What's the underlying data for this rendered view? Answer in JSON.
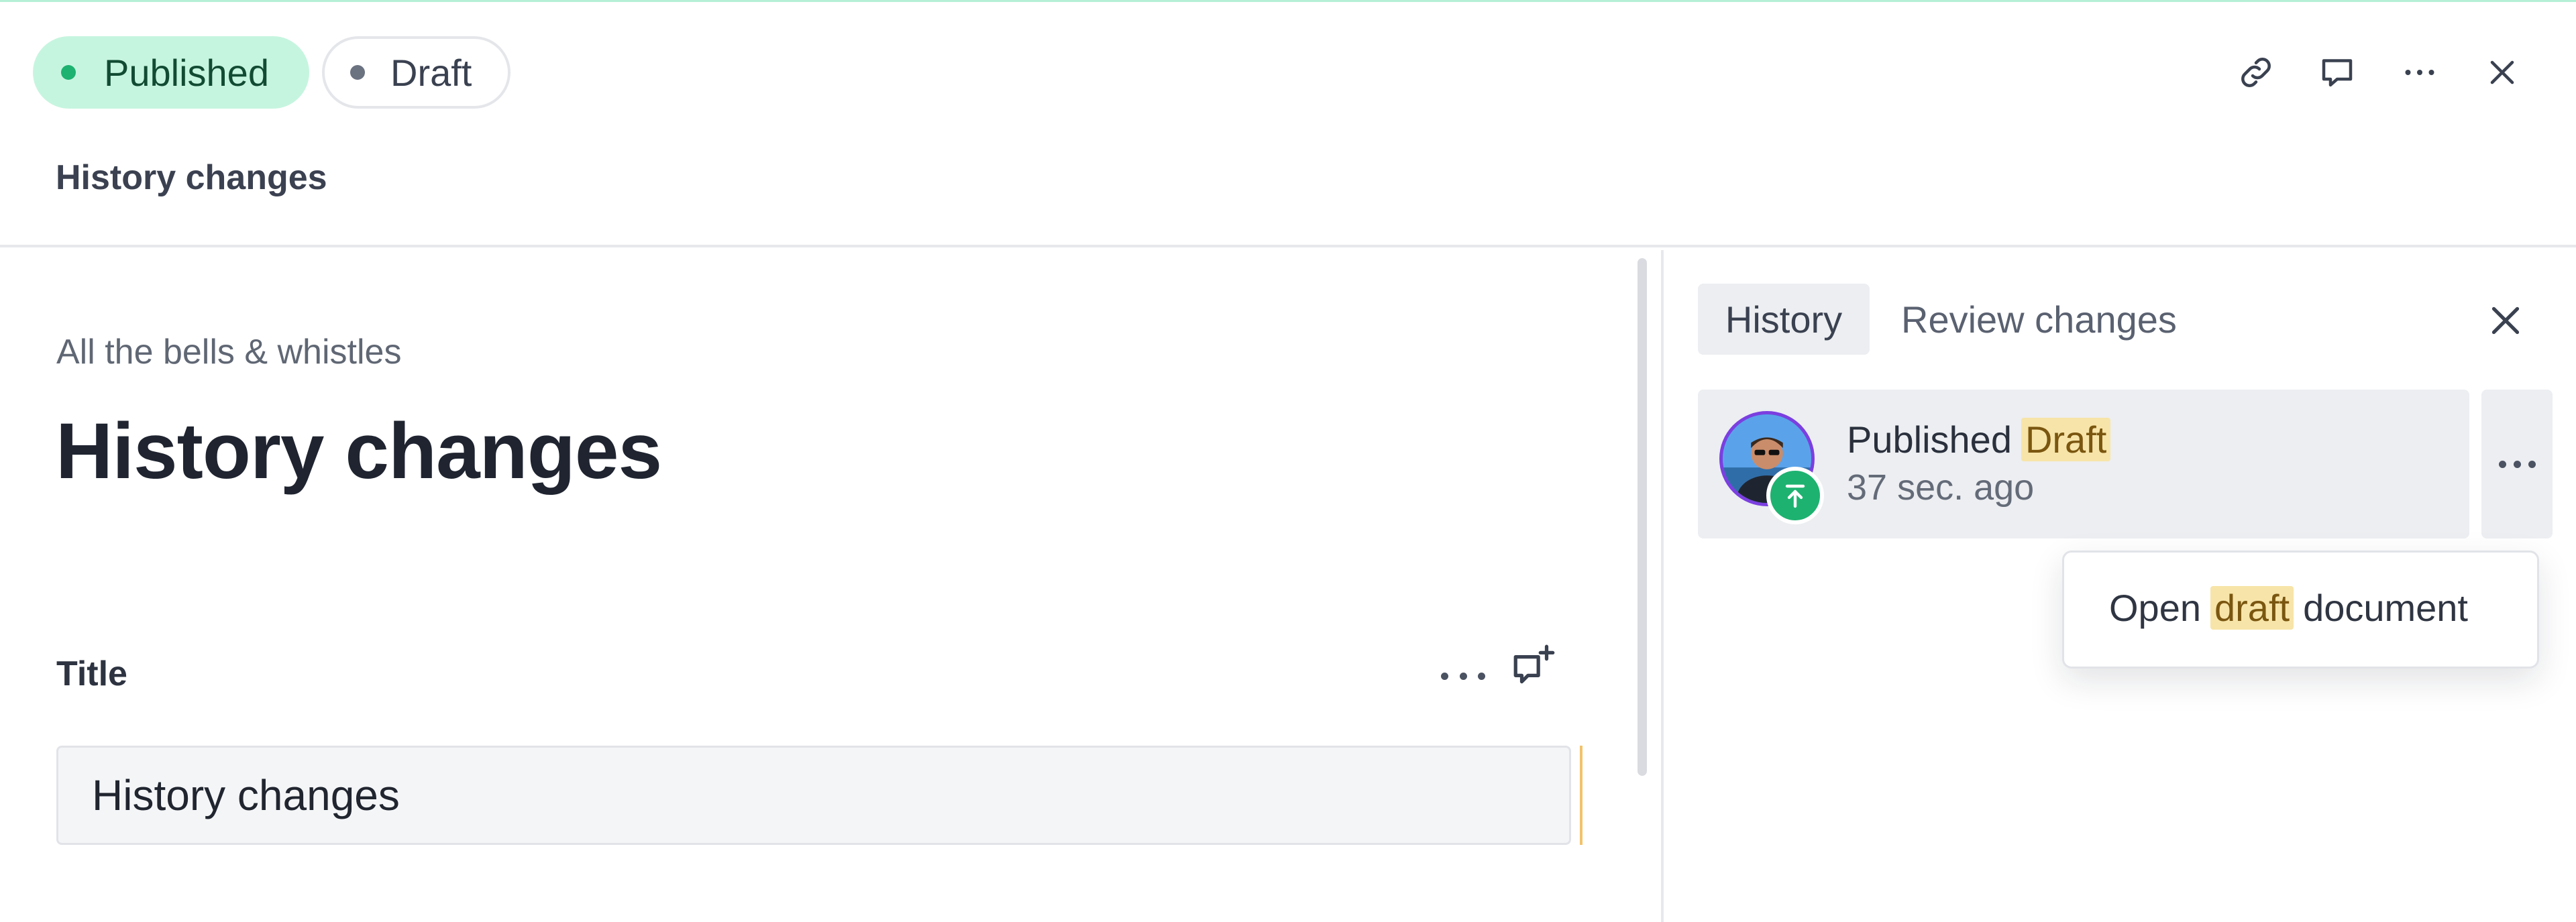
{
  "header": {
    "status_published": "Published",
    "status_draft": "Draft",
    "document_title": "History changes",
    "icons": [
      "link-icon",
      "comment-icon",
      "more-icon",
      "close-icon"
    ]
  },
  "document": {
    "breadcrumb": "All the bells & whistles",
    "title": "History changes",
    "field": {
      "label": "Title",
      "value": "History changes"
    }
  },
  "panel": {
    "tabs": [
      "History",
      "Review changes"
    ],
    "active_tab": "History",
    "entry": {
      "action": "Published",
      "tag": "Draft",
      "time": "37 sec. ago"
    },
    "menu": {
      "prefix": "Open",
      "highlight": "draft",
      "suffix": "document"
    }
  },
  "colors": {
    "published_bg": "#c6f5df",
    "published_dot": "#1db270",
    "highlight_bg": "#f7e4a8",
    "avatar_ring": "#7b3fe0"
  }
}
